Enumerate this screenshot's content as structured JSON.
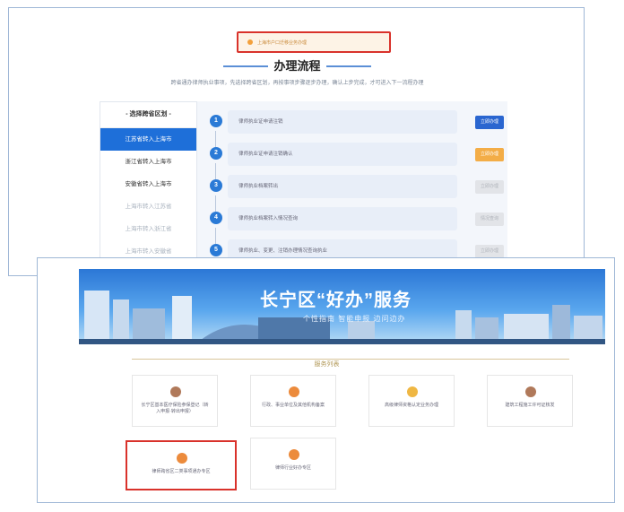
{
  "process": {
    "notice": "上海市户口迁移业务办理",
    "title": "办理流程",
    "subtitle": "跨省通办律师执业事项，先选择跨省区划，再按事项步骤逐步办理，确认上步完成，才可进入下一流程办理",
    "region_header": "- 选择跨省区划 -",
    "regions": [
      {
        "label": "江苏省转入上海市"
      },
      {
        "label": "浙江省转入上海市"
      },
      {
        "label": "安徽省转入上海市"
      },
      {
        "label": "上海市转入江苏省"
      },
      {
        "label": "上海市转入浙江省"
      },
      {
        "label": "上海市转入安徽省"
      }
    ],
    "steps": [
      {
        "num": "1",
        "label": "律师执业证申请注销",
        "button": "立即办理"
      },
      {
        "num": "2",
        "label": "律师执业证申请注销确认",
        "button": "立即办理"
      },
      {
        "num": "3",
        "label": "律师执业档案转出",
        "button": "立即办理"
      },
      {
        "num": "4",
        "label": "律师执业档案转入情况查询",
        "button": "情况查询"
      },
      {
        "num": "5",
        "label": "律师执业、变更、注销办理情况查询执业",
        "button": "立即办理"
      }
    ]
  },
  "services": {
    "banner_title": "长宁区“好办”服务",
    "banner_subtitle": "个性指南  智能申报  边问边办",
    "section_title": "服务列表",
    "cards": [
      {
        "label": "长宁区基本医疗保险参保登记（转入申报·转出申报）",
        "icon": "document-icon"
      },
      {
        "label": "行政、事业单位及其他机构备案",
        "icon": "building-icon"
      },
      {
        "label": "高级律师资格认定业务办理",
        "icon": "certificate-icon"
      },
      {
        "label": "建筑工程施工许可证核发",
        "icon": "construction-icon"
      },
      {
        "label": "律师跨省区二类事项通办专区",
        "icon": "lawyer-icon"
      },
      {
        "label": "律师行业好办专区",
        "icon": "scale-icon"
      }
    ]
  }
}
